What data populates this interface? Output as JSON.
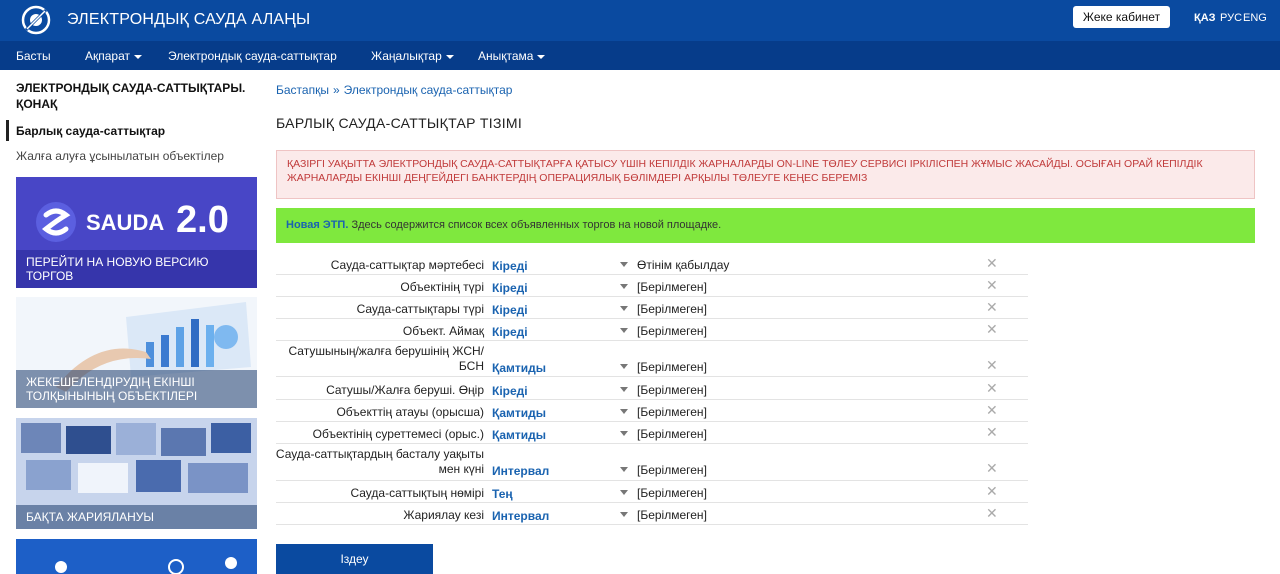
{
  "header": {
    "site_title": "ЭЛЕКТРОНДЫҚ САУДА АЛАҢЫ",
    "cabinet_button": "Жеке кабинет",
    "languages": [
      "ҚАЗ",
      "РУС",
      "ENG"
    ],
    "active_language": "ҚАЗ"
  },
  "nav": {
    "items": [
      {
        "label": "Басты",
        "dropdown": false
      },
      {
        "label": "Ақпарат",
        "dropdown": true
      },
      {
        "label": "Электрондық сауда-саттықтар",
        "dropdown": false
      },
      {
        "label": "Жаңалықтар",
        "dropdown": true
      },
      {
        "label": "Анықтама",
        "dropdown": true
      }
    ]
  },
  "sidebar": {
    "title": "ЭЛЕКТРОНДЫҚ САУДА-САТТЫҚТАРЫ. ҚОНАҚ",
    "active_link": "Барлық сауда-саттықтар",
    "link": "Жалға алуға ұсынылатын объектілер",
    "banners": [
      {
        "logo_text": "SAUDA",
        "version": "2.0",
        "caption": "ПЕРЕЙТИ НА НОВУЮ ВЕРСИЮ ТОРГОВ"
      },
      {
        "caption": "ЖЕКЕШЕЛЕНДІРУДІҢ ЕКІНШІ ТОЛҚЫНЫНЫҢ ОБЪЕКТІЛЕРІ"
      },
      {
        "caption": "БАҚТА ЖАРИЯЛАНУЫ"
      },
      {
        "caption": ""
      }
    ]
  },
  "breadcrumb": {
    "home": "Бастапқы",
    "separator": "»",
    "current": "Электрондық сауда-саттықтар"
  },
  "page_title": "БАРЛЫҚ САУДА-САТТЫҚТАР ТІЗІМІ",
  "alerts": {
    "warning": "ҚАЗІРГІ УАҚЫТТА ЭЛЕКТРОНДЫҚ САУДА-САТТЫҚТАРҒА ҚАТЫСУ ҮШІН КЕПІЛДІК ЖАРНАЛАРДЫ ON-LINE ТӨЛЕУ СЕРВИСІ ІРКІЛІСПЕН ЖҰМЫС ЖАСАЙДЫ. ОСЫҒАН ОРАЙ КЕПІЛДІК ЖАРНАЛАРДЫ ЕКІНШІ ДЕҢГЕЙДЕГІ БАНКТЕРДІҢ ОПЕРАЦИЯЛЫҚ БӨЛІМДЕРІ АРҚЫЛЫ ТӨЛЕУГЕ КЕҢЕС БЕРЕМІЗ",
    "info_bold": "Новая ЭТП.",
    "info_text": "Здесь содержится список всех объявленных торгов на новой площадке."
  },
  "filters": [
    {
      "label": "Сауда-саттықтар мәртебесі",
      "operator": "Кіреді",
      "value": "Өтінім қабылдау"
    },
    {
      "label": "Объектінің түрі",
      "operator": "Кіреді",
      "value": "[Берілмеген]"
    },
    {
      "label": "Сауда-саттықтары түрі",
      "operator": "Кіреді",
      "value": "[Берілмеген]"
    },
    {
      "label": "Объект. Аймақ",
      "operator": "Кіреді",
      "value": "[Берілмеген]"
    },
    {
      "label": "Сатушының/жалға берушінің ЖСН/БСН",
      "operator": "Қамтиды",
      "value": "[Берілмеген]"
    },
    {
      "label": "Сатушы/Жалға беруші. Өңір",
      "operator": "Кіреді",
      "value": "[Берілмеген]"
    },
    {
      "label": "Объекттің атауы (орысша)",
      "operator": "Қамтиды",
      "value": "[Берілмеген]"
    },
    {
      "label": "Объектінің суреттемесі (орыс.)",
      "operator": "Қамтиды",
      "value": "[Берілмеген]"
    },
    {
      "label": "Сауда-саттықтардың басталу уақыты мен күні",
      "operator": "Интервал",
      "value": "[Берілмеген]"
    },
    {
      "label": "Сауда-саттықтың нөмірі",
      "operator": "Тең",
      "value": "[Берілмеген]"
    },
    {
      "label": "Жариялау кезі",
      "operator": "Интервал",
      "value": "[Берілмеген]"
    }
  ],
  "search_button": "Іздеу",
  "colors": {
    "header": "#0a4aa0",
    "navbar": "#063c8a",
    "link": "#1a63b0",
    "alert_red": "#c03a3a",
    "alert_green_bg": "#7fe83e"
  }
}
